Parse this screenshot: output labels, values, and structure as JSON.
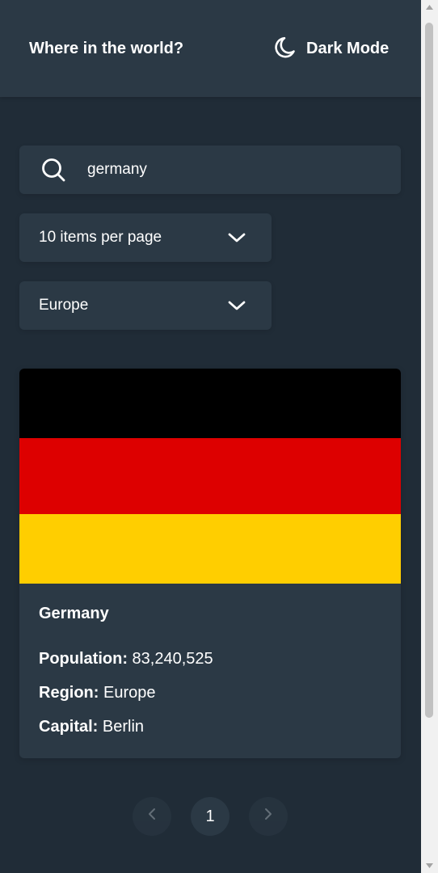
{
  "header": {
    "title": "Where in the world?",
    "theme_toggle_label": "Dark Mode",
    "theme_icon": "moon-icon"
  },
  "search": {
    "value": "germany",
    "icon": "search-icon"
  },
  "filters": {
    "per_page": "10 items per page",
    "region": "Europe",
    "chevron_icon": "chevron-down-icon"
  },
  "countries": [
    {
      "name": "Germany",
      "flag_colors": [
        "#000000",
        "#dd0000",
        "#ffce00"
      ],
      "population_label": "Population:",
      "population": "83,240,525",
      "region_label": "Region:",
      "region": "Europe",
      "capital_label": "Capital:",
      "capital": "Berlin"
    }
  ],
  "pagination": {
    "current_page": "1",
    "prev_icon": "chevron-left-icon",
    "next_icon": "chevron-right-icon"
  },
  "colors": {
    "background": "#202c37",
    "element": "#2b3945",
    "text": "#ffffff"
  }
}
